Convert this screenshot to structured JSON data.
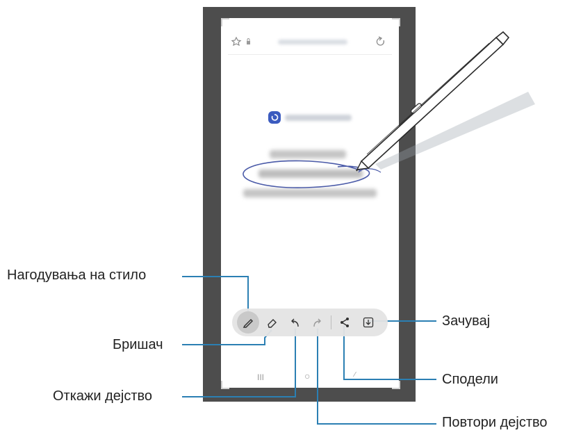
{
  "callouts": {
    "pen_settings": "Нагодувања на стило",
    "eraser": "Бришач",
    "undo": "Откажи дејство",
    "redo": "Повтори дејство",
    "save": "Зачувај",
    "share": "Сподели"
  },
  "toolbar": {
    "items": [
      {
        "name": "pen-settings",
        "icon": "pen-icon",
        "active": true
      },
      {
        "name": "eraser",
        "icon": "eraser-icon",
        "active": false
      },
      {
        "name": "undo",
        "icon": "undo-icon",
        "active": false
      },
      {
        "name": "redo",
        "icon": "redo-icon",
        "active": false
      },
      {
        "name": "share",
        "icon": "share-icon",
        "active": false
      },
      {
        "name": "save",
        "icon": "save-icon",
        "active": false
      }
    ]
  },
  "navbar": {
    "recent": "III",
    "home": "○"
  },
  "colors": {
    "frame": "#4d4d4d",
    "ink": "#4a5aa8",
    "callout_line": "#2b7fb3",
    "app_icon": "#3b5bbf"
  }
}
